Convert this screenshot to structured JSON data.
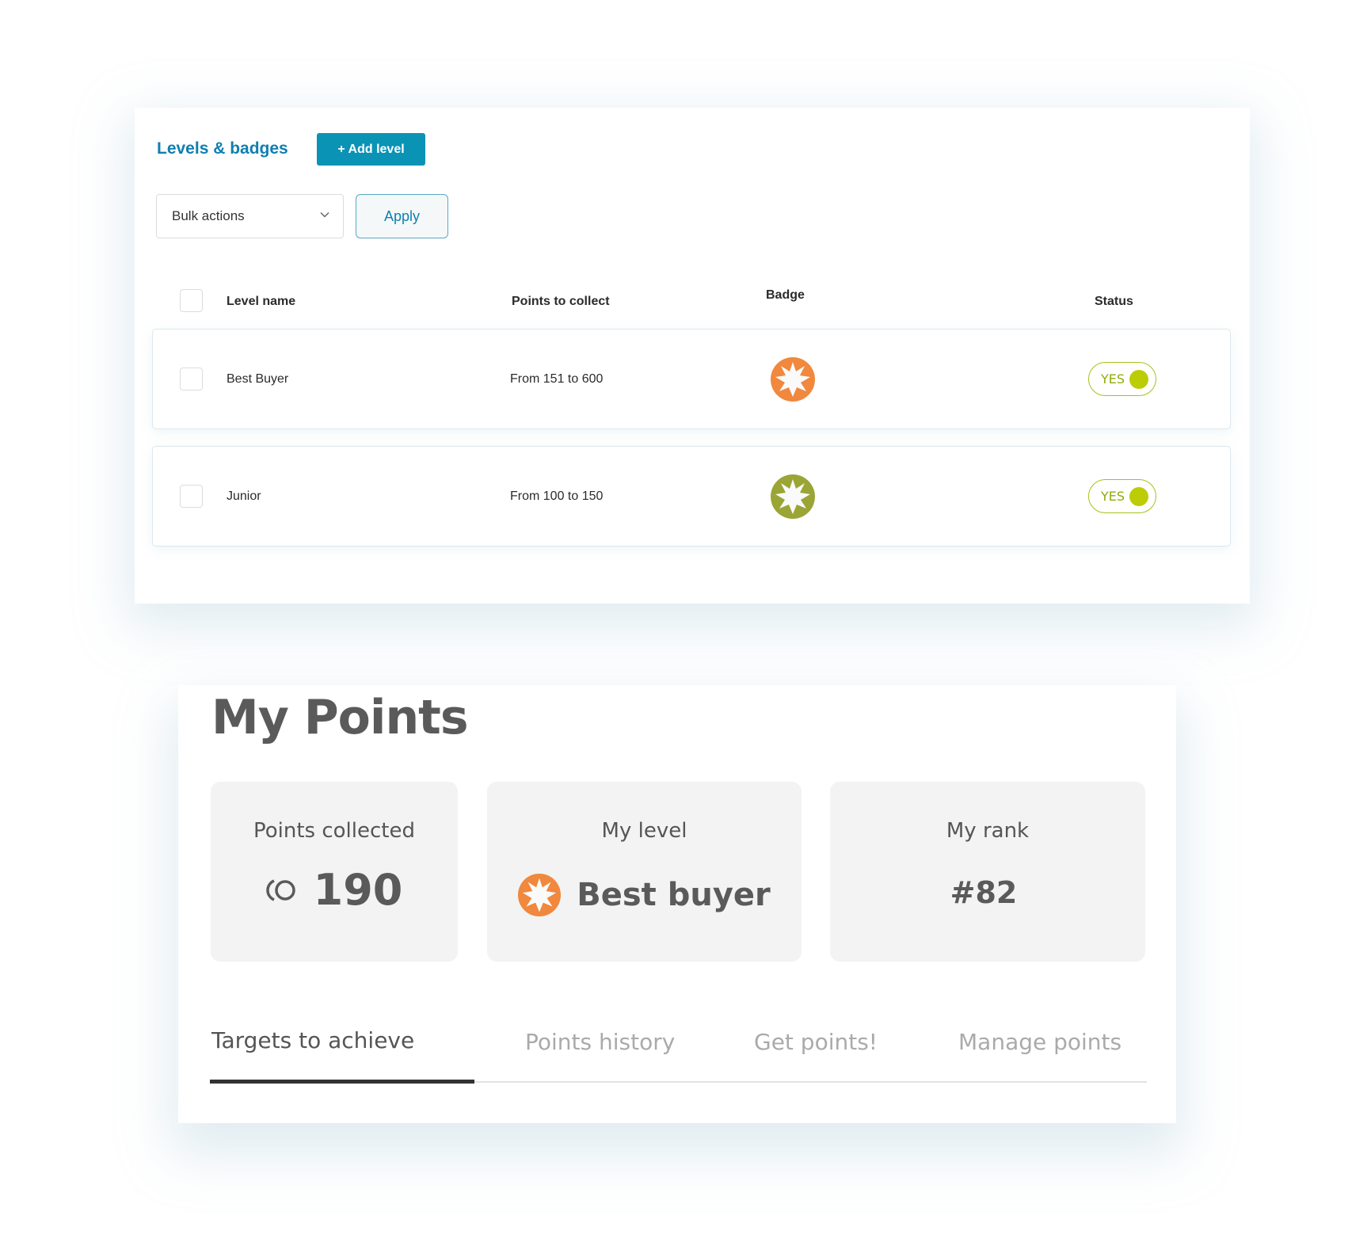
{
  "levels_panel": {
    "title": "Levels & badges",
    "add_button": "+ Add level",
    "bulk_select": {
      "value": "Bulk actions",
      "icon": "chevron-down-icon"
    },
    "apply_button": "Apply",
    "columns": [
      "Level name",
      "Points to collect",
      "Badge",
      "Status"
    ],
    "rows": [
      {
        "name": "Best Buyer",
        "points": "From 151 to 600",
        "badge_color": "#f0883d",
        "status": "YES"
      },
      {
        "name": "Junior",
        "points": "From 100 to 150",
        "badge_color": "#9aa535",
        "status": "YES"
      }
    ],
    "colors": {
      "accent": "#0a93b5",
      "title": "#0f7fb0",
      "toggle": "#bccd07"
    }
  },
  "my_points": {
    "title": "My Points",
    "stats": [
      {
        "label": "Points collected",
        "value": "190",
        "icon": "coins-icon"
      },
      {
        "label": "My level",
        "value": "Best buyer",
        "icon": "badge-icon",
        "badge_color": "#f0883d"
      },
      {
        "label": "My rank",
        "value": "#82"
      }
    ],
    "tabs": [
      {
        "label": "Targets to achieve",
        "active": true
      },
      {
        "label": "Points history",
        "active": false
      },
      {
        "label": "Get points!",
        "active": false
      },
      {
        "label": "Manage points",
        "active": false
      }
    ]
  }
}
